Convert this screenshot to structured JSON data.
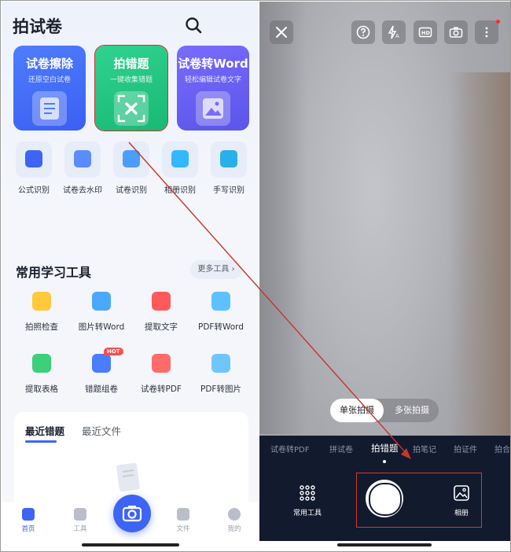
{
  "left": {
    "app_title": "拍试卷",
    "feature_cards": [
      {
        "title": "试卷擦除",
        "subtitle": "还原空白试卷"
      },
      {
        "title": "拍错题",
        "subtitle": "一键收集错题"
      },
      {
        "title": "试卷转Word",
        "subtitle": "轻松编辑试卷文字"
      }
    ],
    "quick_tools": [
      "公式识别",
      "试卷去水印",
      "试卷识别",
      "相册识别",
      "手写识别"
    ],
    "section_title": "常用学习工具",
    "more_tools": "更多工具",
    "study_tools_row1": [
      "拍照检查",
      "图片转Word",
      "提取文字",
      "PDF转Word"
    ],
    "study_tools_row2": [
      "提取表格",
      "错题组卷",
      "试卷转PDF",
      "PDF转图片"
    ],
    "hot_badge": "HOT",
    "recent_tabs": [
      "最近错题",
      "最近文件"
    ],
    "nav": [
      "首页",
      "工具",
      "文件",
      "我的"
    ]
  },
  "right": {
    "mode_single": "单张拍摄",
    "mode_multi": "多张拍摄",
    "panel_tabs": [
      "试卷转PDF",
      "拼试卷",
      "拍错题",
      "拍笔记",
      "拍证件",
      "拍合"
    ],
    "tools_label": "常用工具",
    "album_label": "相册",
    "hd_label": "HD"
  },
  "colors": {
    "accent": "#3d64f5",
    "annotation": "#c7352b",
    "panel_bg": "#121a2e"
  }
}
